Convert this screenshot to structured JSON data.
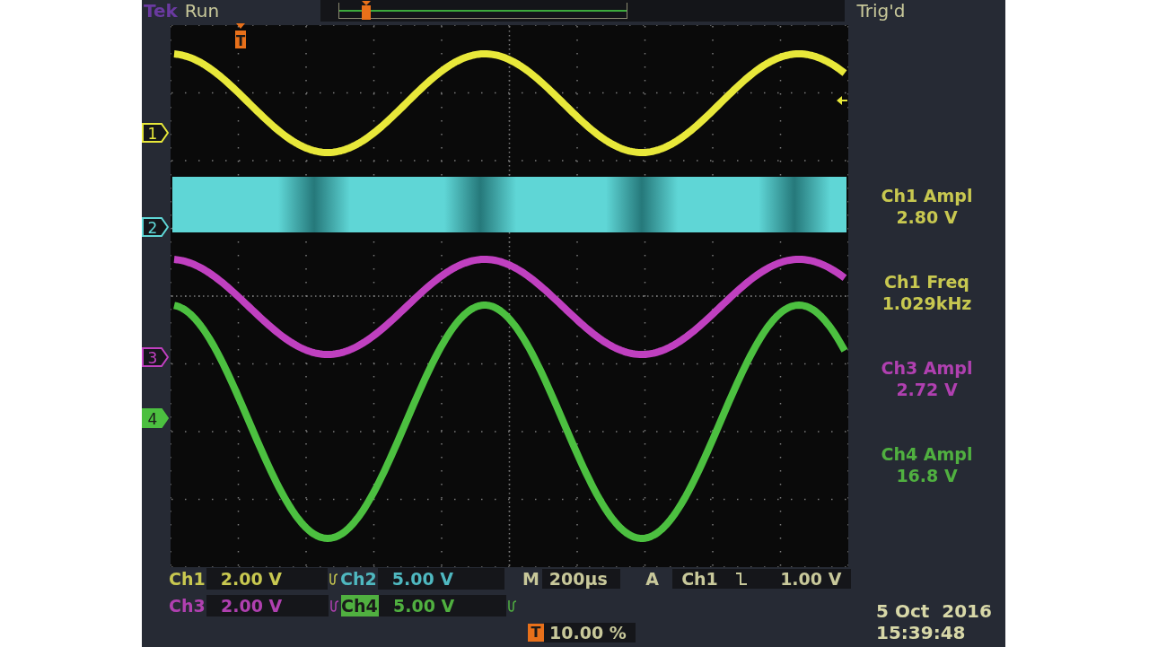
{
  "header": {
    "brand": "Tek",
    "state": "Run",
    "trigger_status": "Trig'd"
  },
  "trigger_marker": "T",
  "channels": [
    {
      "label": "1",
      "kind": "sine",
      "color": "#e8e83a"
    },
    {
      "label": "2",
      "kind": "band",
      "color": "#5fd6d6"
    },
    {
      "label": "3",
      "kind": "sine",
      "color": "#c040c0"
    },
    {
      "label": "4",
      "kind": "sine",
      "color": "#4cc040"
    }
  ],
  "measurements": [
    {
      "name": "Ch1 Ampl",
      "value": "2.80 V",
      "color": "#c8c850"
    },
    {
      "name": "Ch1 Freq",
      "value": "1.029kHz",
      "color": "#c8c850"
    },
    {
      "name": "Ch3 Ampl",
      "value": "2.72 V",
      "color": "#b040b0"
    },
    {
      "name": "Ch4 Ampl",
      "value": "16.8 V",
      "color": "#50b040"
    }
  ],
  "scales": [
    {
      "label": "Ch1",
      "value": "2.00 V",
      "color": "#c8c850",
      "selected": false,
      "bw_limit": true
    },
    {
      "label": "Ch2",
      "value": "5.00 V",
      "color": "#4fb8c0",
      "selected": false,
      "bw_limit": false
    },
    {
      "label": "Ch3",
      "value": "2.00 V",
      "color": "#b040b0",
      "selected": false,
      "bw_limit": true
    },
    {
      "label": "Ch4",
      "value": "5.00 V",
      "color": "#50b040",
      "selected": true,
      "bw_limit": true
    }
  ],
  "timebase": {
    "label": "M",
    "value": "200µs"
  },
  "trigger": {
    "label": "A",
    "source": "Ch1",
    "falling_edge": true,
    "level": "1.00 V"
  },
  "trigger_position": {
    "icon": "T",
    "value": "10.00 %"
  },
  "date": "5 Oct  2016",
  "time": "15:39:48"
}
